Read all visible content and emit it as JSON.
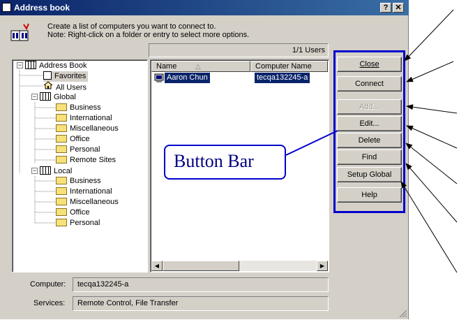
{
  "window": {
    "title": "Address book"
  },
  "titlebar_buttons": {
    "help": "?",
    "close": "✕"
  },
  "header": {
    "line1": "Create a list of computers you want to connect to.",
    "line2": "Note: Right-click on a folder or entry to select more options."
  },
  "status": {
    "user_count": "1/1 Users"
  },
  "tree": {
    "root": "Address Book",
    "favorites": "Favorites",
    "all_users": "All Users",
    "global": {
      "label": "Global",
      "children": [
        "Business",
        "International",
        "Miscellaneous",
        "Office",
        "Personal",
        "Remote Sites"
      ]
    },
    "local": {
      "label": "Local",
      "children": [
        "Business",
        "International",
        "Miscellaneous",
        "Office",
        "Personal"
      ]
    }
  },
  "list": {
    "columns": [
      "Name",
      "Computer Name"
    ],
    "rows": [
      {
        "name": "Aaron Chun",
        "computer": "tecqa132245-a"
      }
    ]
  },
  "details": {
    "computer_label": "Computer:",
    "computer_value": "tecqa132245-a",
    "services_label": "Services:",
    "services_value": "Remote Control, File Transfer"
  },
  "buttons": {
    "close": "Close",
    "connect": "Connect",
    "add": "Add...",
    "edit": "Edit...",
    "delete": "Delete",
    "find": "Find",
    "setup_global": "Setup Global",
    "help": "Help"
  },
  "annotation": {
    "callout": "Button Bar"
  },
  "colors": {
    "titlebar": "#0a246a",
    "selection": "#0a246a",
    "annotation_blue": "#0000cc"
  },
  "icons": {
    "title": "address-book-icon",
    "header": "address-book-doc-icon",
    "folder": "folder-icon",
    "computer": "computer-icon"
  }
}
